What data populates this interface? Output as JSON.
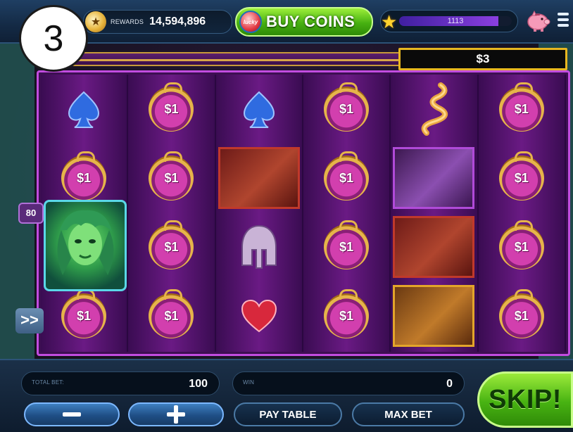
{
  "top_bar": {
    "level": "3",
    "rewards_label": "REWARDS",
    "rewards_value": "14,594,896",
    "buy_coins_label": "BUY COINS",
    "lucky_badge": "lucky",
    "xp_value": "1113",
    "xp_progress_fraction": 0.88
  },
  "jackpot": {
    "value": "$3"
  },
  "reels": {
    "coin_label": "$1",
    "columns": [
      [
        "spade",
        "coin",
        "medusa",
        "coin"
      ],
      [
        "coin",
        "coin",
        "coin",
        "coin"
      ],
      [
        "spade",
        "hero-kiss",
        "helmet",
        "heart"
      ],
      [
        "coin",
        "coin",
        "coin",
        "coin"
      ],
      [
        "snake",
        "cyclops",
        "hero-kiss",
        "satyr"
      ],
      [
        "coin",
        "coin",
        "coin",
        "coin"
      ]
    ]
  },
  "side": {
    "lines_count": "80",
    "fast_forward_label": ">>"
  },
  "bottom_bar": {
    "total_bet_label": "TOTAL BET:",
    "total_bet_value": "100",
    "win_label": "WIN",
    "win_value": "0",
    "pay_table_label": "PAY TABLE",
    "max_bet_label": "MAX BET",
    "skip_label": "SKIP!"
  },
  "colors": {
    "accent_green": "#48b312",
    "jackpot_border": "#e8b720",
    "reel_purple": "#6a1a84"
  }
}
